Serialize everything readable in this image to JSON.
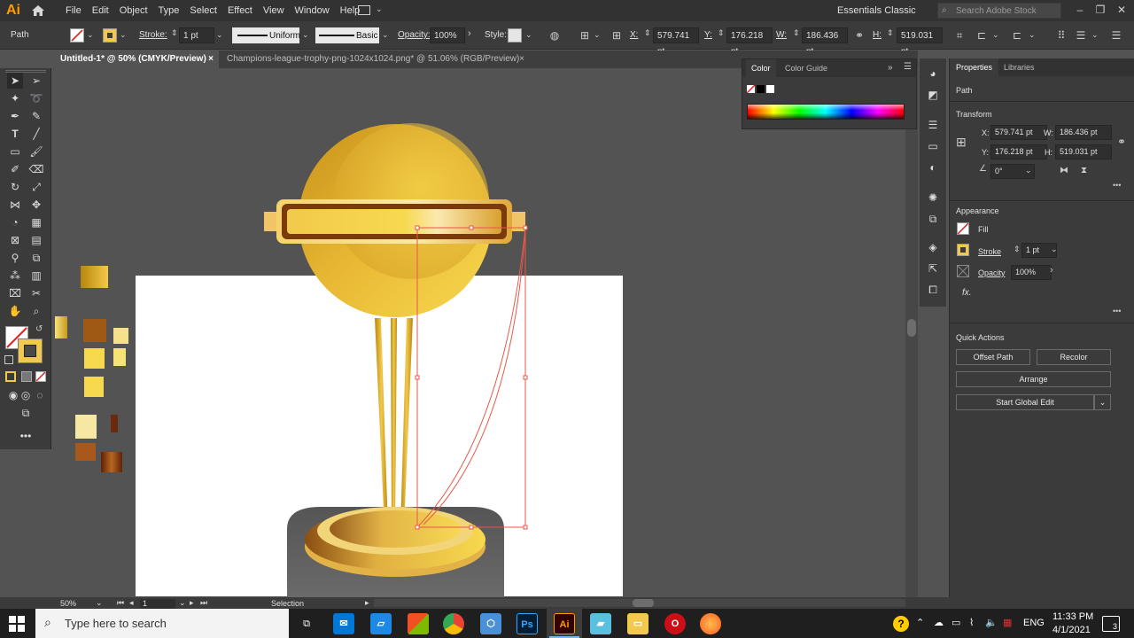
{
  "app": {
    "logo": "Ai",
    "menu": [
      "File",
      "Edit",
      "Object",
      "Type",
      "Select",
      "Effect",
      "View",
      "Window",
      "Help"
    ],
    "workspace": "Essentials Classic",
    "search_placeholder": "Search Adobe Stock"
  },
  "control": {
    "selection_label": "Path",
    "stroke_label": "Stroke:",
    "stroke_weight": "1 pt",
    "profile": "Uniform",
    "brush": "Basic",
    "opacity_label": "Opacity:",
    "opacity": "100%",
    "style_label": "Style:",
    "x_label": "X:",
    "x": "579.741 pt",
    "y_label": "Y:",
    "y": "176.218 pt",
    "w_label": "W:",
    "w": "186.436 pt",
    "h_label": "H:",
    "h": "519.031 pt"
  },
  "tabs": [
    {
      "label": "Untitled-1* @ 50% (CMYK/Preview)",
      "close": "×"
    },
    {
      "label": "Champions-league-trophy-png-1024x1024.png* @ 51.06% (RGB/Preview)",
      "close": "×"
    }
  ],
  "color_panel": {
    "tabs": [
      "Color",
      "Color Guide"
    ],
    "more": "»"
  },
  "properties": {
    "tabs": [
      "Properties",
      "Libraries"
    ],
    "selection": "Path",
    "transform_title": "Transform",
    "x_label": "X:",
    "x": "579.741 pt",
    "y_label": "Y:",
    "y": "176.218 pt",
    "w_label": "W:",
    "w": "186.436 pt",
    "h_label": "H:",
    "h": "519.031 pt",
    "angle": "0°",
    "appearance_title": "Appearance",
    "fill_label": "Fill",
    "stroke_label": "Stroke",
    "stroke_weight": "1 pt",
    "opacity_label": "Opacity",
    "opacity": "100%",
    "fx_label": "fx.",
    "quick_actions_title": "Quick Actions",
    "offset_path": "Offset Path",
    "recolor": "Recolor",
    "arrange": "Arrange",
    "global_edit": "Start Global Edit",
    "more": "•••"
  },
  "status": {
    "zoom": "50%",
    "artboard": "1",
    "tool": "Selection"
  },
  "taskbar": {
    "search_placeholder": "Type here to search",
    "language": "ENG",
    "time": "11:33 PM",
    "date": "4/1/2021",
    "notifications": "3",
    "ps_label": "Ps",
    "ai_label": "Ai"
  },
  "colors": {
    "accent_gold": "#f2c94c",
    "dark_gold": "#b8860b",
    "selection": "#e8574a"
  }
}
